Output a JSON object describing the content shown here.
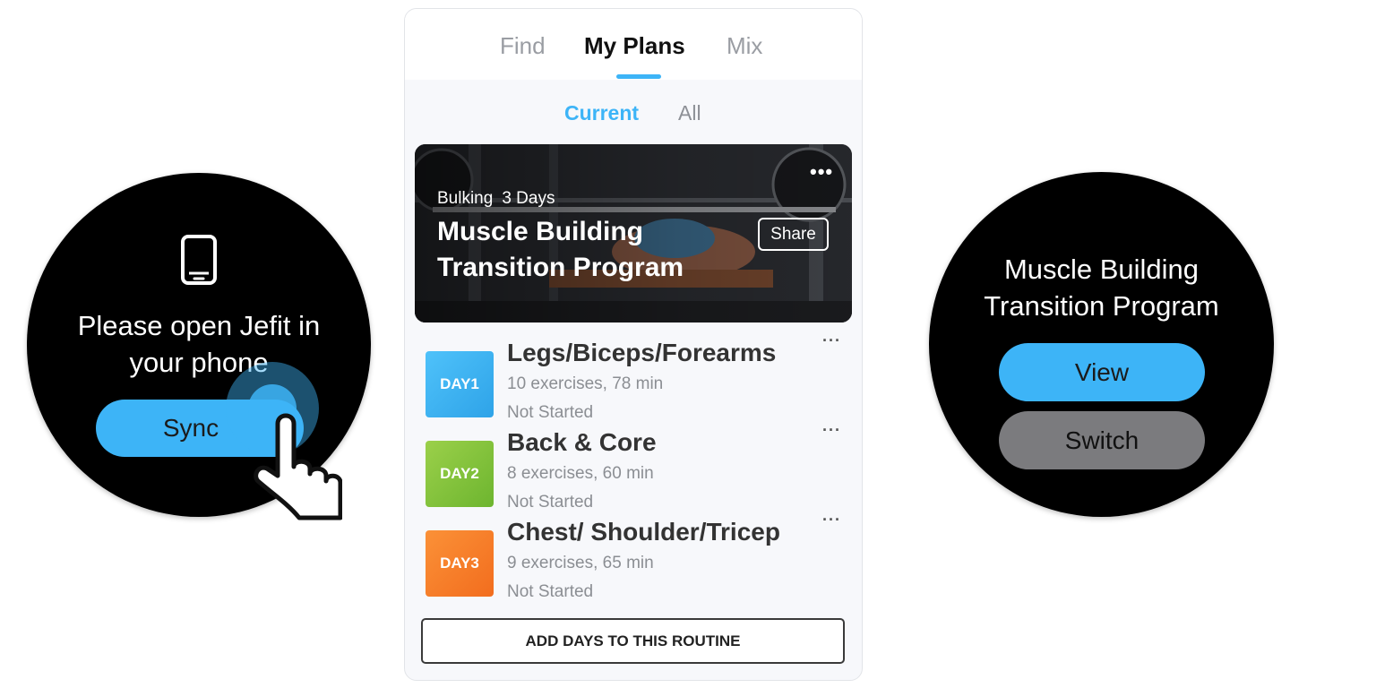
{
  "left_watch": {
    "message": "Please open Jefit in your phone",
    "sync_label": "Sync",
    "phone_icon": "smartphone-icon",
    "hand_icon": "pointing-hand-icon"
  },
  "phone": {
    "top_tabs": [
      {
        "label": "Find"
      },
      {
        "label": "My Plans"
      },
      {
        "label": "Mix"
      }
    ],
    "sub_tabs": [
      {
        "label": "Current"
      },
      {
        "label": "All"
      }
    ],
    "banner": {
      "tag_goal": "Bulking",
      "tag_days": "3 Days",
      "title": "Muscle Building Transition Program",
      "share_label": "Share",
      "more_icon": "more-horizontal-icon"
    },
    "days": [
      {
        "badge": "DAY1",
        "title": "Legs/Biceps/Forearms",
        "meta": "10 exercises, 78 min",
        "status": "Not Started",
        "color": "#3db4f7"
      },
      {
        "badge": "DAY2",
        "title": "Back & Core",
        "meta": "8 exercises, 60 min",
        "status": "Not Started",
        "color": "#8bc63f"
      },
      {
        "badge": "DAY3",
        "title": "Chest/ Shoulder/Tricep",
        "meta": "9 exercises, 65 min",
        "status": "Not Started",
        "color": "#f7842a"
      }
    ],
    "add_days_label": "ADD DAYS TO THIS ROUTINE"
  },
  "right_watch": {
    "title": "Muscle Building Transition Program",
    "view_label": "View",
    "switch_label": "Switch"
  },
  "colors": {
    "accent": "#3db4f7",
    "switch_gray": "#7b7b7e"
  }
}
